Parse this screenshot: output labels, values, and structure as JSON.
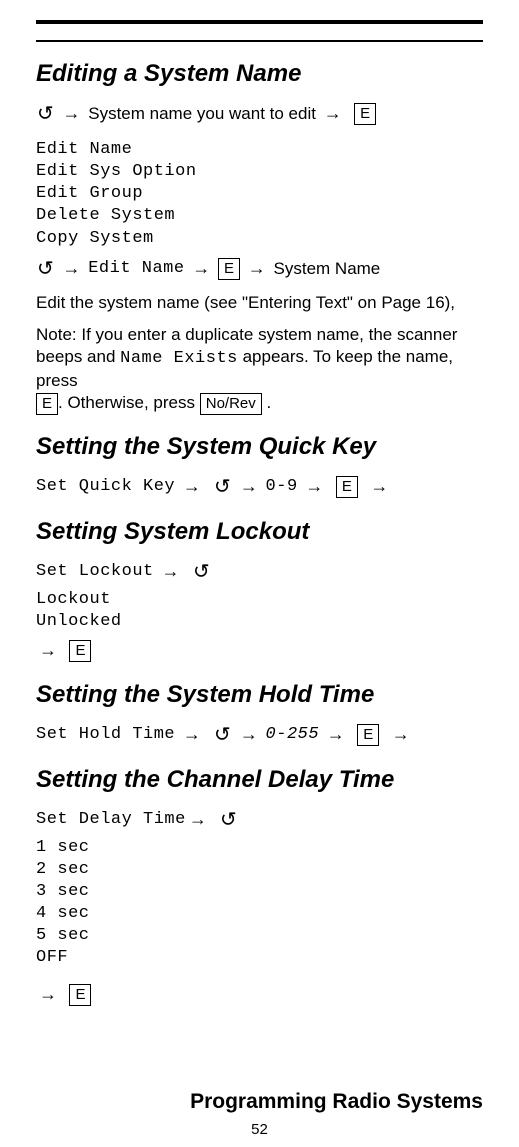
{
  "h1": "Editing a System Name",
  "step1": {
    "t1": "System name you want to edit",
    "key": "E"
  },
  "menu1": [
    "Edit Name",
    "Edit Sys Option",
    "Edit Group",
    "Delete System",
    "Copy System"
  ],
  "step2": {
    "m": "Edit Name",
    "key": "E",
    "t": "System Name"
  },
  "para1": "Edit the system name (see \"Entering Text\" on Page 16),",
  "para2a": "Note: If you enter a duplicate system name, the scanner beeps and ",
  "para2b": "Name Exists",
  "para2c": " appears. To keep the name, press ",
  "para2key1": "E",
  "para2d": ". Otherwise, press ",
  "para2key2": "No/Rev",
  "para2e": " .",
  "h2": "Setting the System Quick Key",
  "qk": {
    "m": "Set Quick Key",
    "r": "0-9",
    "key": "E"
  },
  "h3": "Setting System Lockout",
  "lk": {
    "m": "Set Lockout",
    "opts": [
      "Lockout",
      "Unlocked"
    ],
    "key": "E"
  },
  "h4": "Setting the System Hold Time",
  "ht": {
    "m": "Set Hold Time",
    "r": "0-255",
    "key": "E"
  },
  "h5": "Setting the Channel Delay Time",
  "dt": {
    "m": "Set Delay Time",
    "opts": [
      "1 sec",
      "2 sec",
      "3 sec",
      "4 sec",
      "5 sec",
      "OFF"
    ],
    "key": "E"
  },
  "footer": "Programming Radio Systems",
  "page": "52"
}
